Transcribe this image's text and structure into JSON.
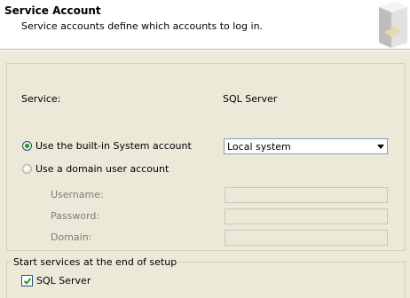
{
  "header": {
    "title": "Service Account",
    "subtitle": "Service accounts define which accounts to log in."
  },
  "service": {
    "label": "Service:",
    "value": "SQL Server"
  },
  "account": {
    "builtin_label": "Use the built-in System account",
    "builtin_selected": true,
    "domain_label": "Use a domain user account",
    "domain_selected": false,
    "system_account_select": "Local system"
  },
  "domain_fields": {
    "username_label": "Username:",
    "username_value": "",
    "password_label": "Password:",
    "password_value": "",
    "domain_label": "Domain:",
    "domain_value": ""
  },
  "startup": {
    "group_title": "Start services at the end of setup",
    "sql_server_label": "SQL Server",
    "sql_server_checked": true
  },
  "colors": {
    "radio_dot": "#21a121",
    "checkmark": "#21a121",
    "dialog_bg": "#ece9d8"
  }
}
